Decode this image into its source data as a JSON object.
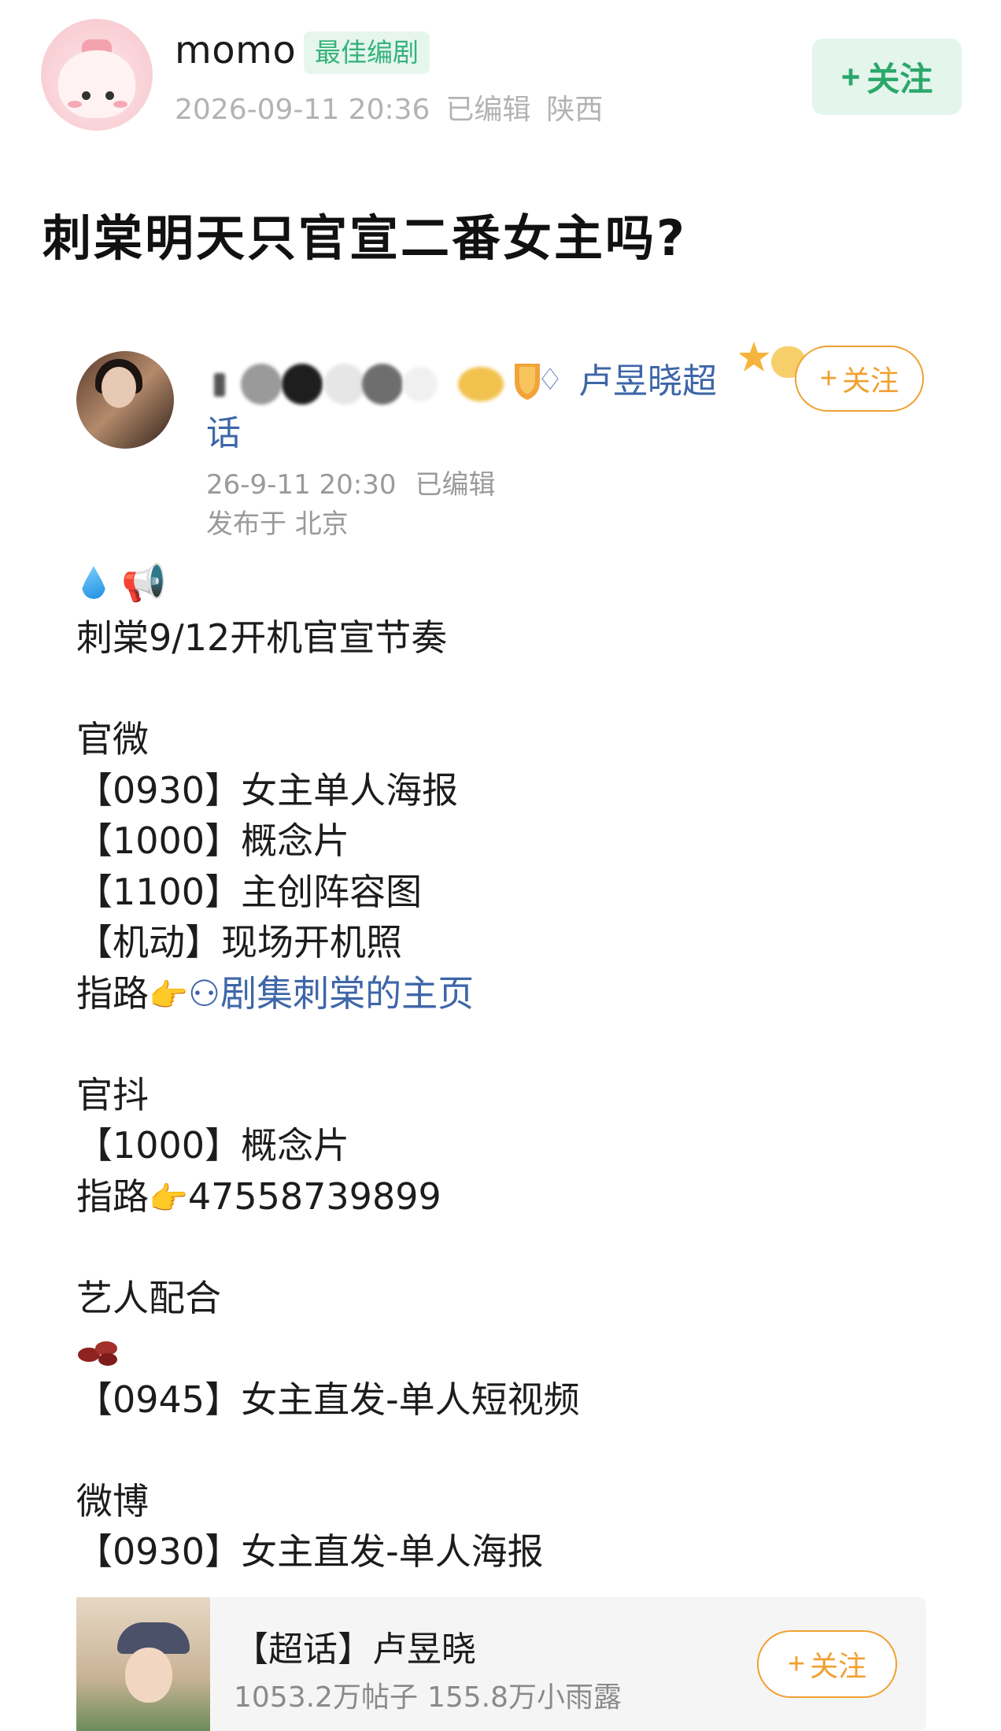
{
  "header": {
    "username": "momo",
    "badge": "最佳编剧",
    "date": "2026-09-11 20:36",
    "edited": "已编辑",
    "location": "陕西",
    "follow_plus": "+",
    "follow_label": "关注"
  },
  "post": {
    "title": "刺棠明天只官宣二番女主吗?"
  },
  "quoted": {
    "supertopic_line1": "卢昱晓超",
    "supertopic_line2": "话",
    "follow_plus": "+",
    "follow_label": "关注",
    "time": "26-9-11 20:30",
    "edited": "已编辑",
    "location": "发布于 北京",
    "lines": [
      "刺棠9/12开机官宣节奏",
      "",
      "官微",
      "【0930】女主单人海报",
      "【1000】概念片",
      "【1100】主创阵容图",
      "【机动】现场开机照"
    ],
    "guide_label": "指路",
    "guide_link": "剧集刺棠的主页",
    "lines2": [
      "",
      "官抖",
      "【1000】概念片"
    ],
    "guide2": "47558739899",
    "lines3": [
      "",
      "艺人配合"
    ],
    "lines4": [
      "【0945】女主直发-单人短视频",
      "",
      "微博",
      "【0930】女主直发-单人海报"
    ]
  },
  "card": {
    "title": "【超话】卢昱晓",
    "posts": "1053.2万帖子",
    "fans": "155.8万小雨露",
    "follow_plus": "+",
    "follow_label": "关注"
  },
  "colors": {
    "badge_green": "#36b27a",
    "link_blue": "#3e66a8",
    "follow_orange": "#f0a030"
  }
}
